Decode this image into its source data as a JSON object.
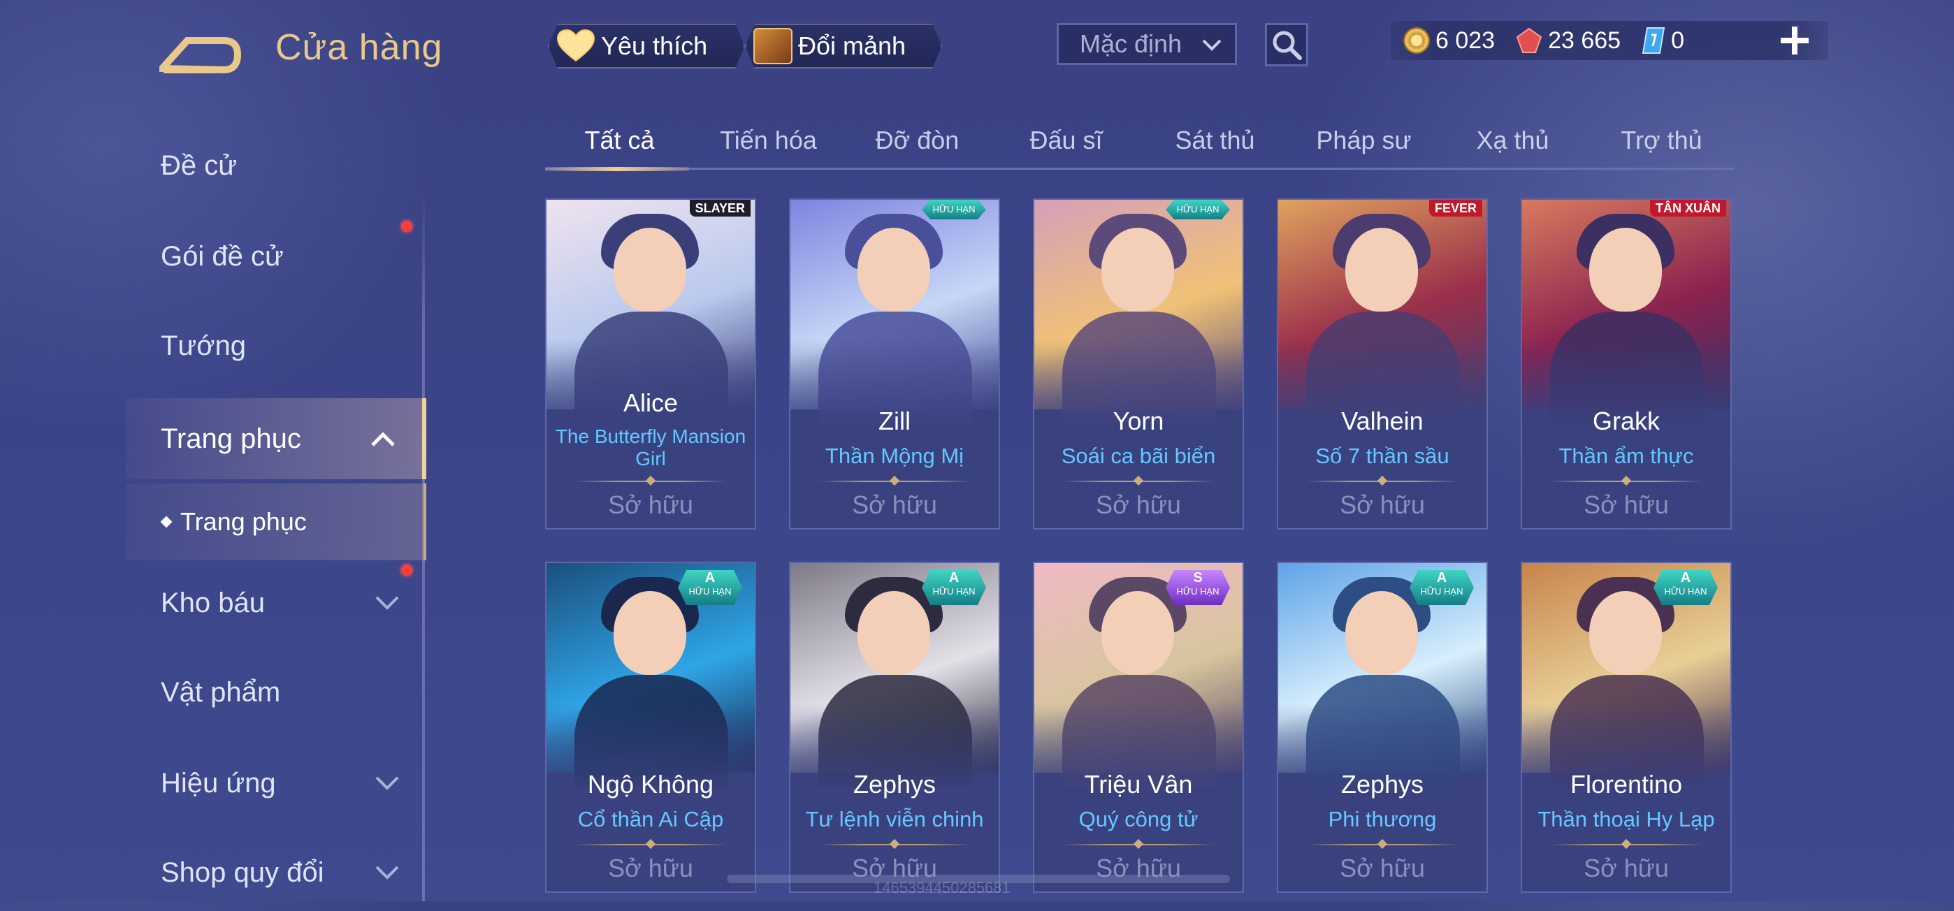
{
  "header": {
    "title": "Cửa hàng",
    "favorites_label": "Yêu thích",
    "fragments_label": "Đổi mảnh",
    "sort_value": "Mặc định",
    "currencies": {
      "gold": "6 023",
      "quan_huy": "23 665",
      "voucher": "0"
    }
  },
  "sidebar": {
    "items": [
      {
        "label": "Đề cử"
      },
      {
        "label": "Gói đề cử"
      },
      {
        "label": "Tướng"
      },
      {
        "label": "Trang phục"
      },
      {
        "label": "Kho báu"
      },
      {
        "label": "Vật phẩm"
      },
      {
        "label": "Hiệu ứng"
      },
      {
        "label": "Shop quy đổi"
      }
    ],
    "sub_item": "Trang phục"
  },
  "tabs": [
    "Tất cả",
    "Tiến hóa",
    "Đỡ đòn",
    "Đấu sĩ",
    "Sát thủ",
    "Pháp sư",
    "Xạ thủ",
    "Trợ thủ"
  ],
  "cards": [
    {
      "hero": "Alice",
      "skin_line1": "The Butterfly Mansion",
      "skin_line2": "Girl",
      "status": "Sở hữu",
      "corner_tag": "SLAYER",
      "colors": [
        "#efe3ee",
        "#b9c9ee",
        "#3a3f7a"
      ]
    },
    {
      "hero": "Zill",
      "skin_line1": "Thần Mộng Mị",
      "skin_line2": "",
      "status": "Sở hữu",
      "badge_text": "HỮU HẠN",
      "colors": [
        "#7f83e0",
        "#c7d7f6",
        "#4a4f9a"
      ]
    },
    {
      "hero": "Yorn",
      "skin_line1": "Soái ca bãi biển",
      "skin_line2": "",
      "status": "Sở hữu",
      "badge_text": "HỮU HẠN",
      "colors": [
        "#d4a0b8",
        "#f0c276",
        "#5c4a7a"
      ]
    },
    {
      "hero": "Valhein",
      "skin_line1": "Số 7 thần sầu",
      "skin_line2": "",
      "status": "Sở hữu",
      "corner_tag": "FEVER",
      "colors": [
        "#e0a25f",
        "#9a2f4b",
        "#4c3c6e"
      ]
    },
    {
      "hero": "Grakk",
      "skin_line1": "Thần ẩm thực",
      "skin_line2": "",
      "status": "Sở hữu",
      "corner_tag": "TÂN XUÂN",
      "colors": [
        "#d77a5e",
        "#8b2350",
        "#3c2f62"
      ]
    },
    {
      "hero": "Ngộ Không",
      "skin_line1": "Cổ thần Ai Cập",
      "skin_line2": "",
      "status": "Sở hữu",
      "badge_rank": "A",
      "badge_text": "HỮU HẠN",
      "colors": [
        "#1b4f7e",
        "#2fa5e6",
        "#1a2850"
      ]
    },
    {
      "hero": "Zephys",
      "skin_line1": "Tư lệnh viễn chinh",
      "skin_line2": "",
      "status": "Sở hữu",
      "badge_rank": "A",
      "badge_text": "HỮU HẠN",
      "colors": [
        "#7c7a86",
        "#e4e0e8",
        "#2c2b40"
      ]
    },
    {
      "hero": "Triệu Vân",
      "skin_line1": "Quý công tử",
      "skin_line2": "",
      "status": "Sở hữu",
      "badge_rank": "S",
      "badge_text": "HỮU HẠN",
      "colors": [
        "#f0b9c4",
        "#d7c59e",
        "#5a4866"
      ]
    },
    {
      "hero": "Zephys",
      "skin_line1": "Phi thương",
      "skin_line2": "",
      "status": "Sở hữu",
      "badge_rank": "A",
      "badge_text": "HỮU HẠN",
      "colors": [
        "#5fa3e8",
        "#d7eefc",
        "#2d4e85"
      ]
    },
    {
      "hero": "Florentino",
      "skin_line1": "Thần thoại Hy Lạp",
      "skin_line2": "",
      "status": "Sở hữu",
      "badge_rank": "A",
      "badge_text": "HỮU HẠN",
      "colors": [
        "#c7844a",
        "#e8cf96",
        "#4a3151"
      ]
    }
  ],
  "footer_id": "1465394450285681"
}
